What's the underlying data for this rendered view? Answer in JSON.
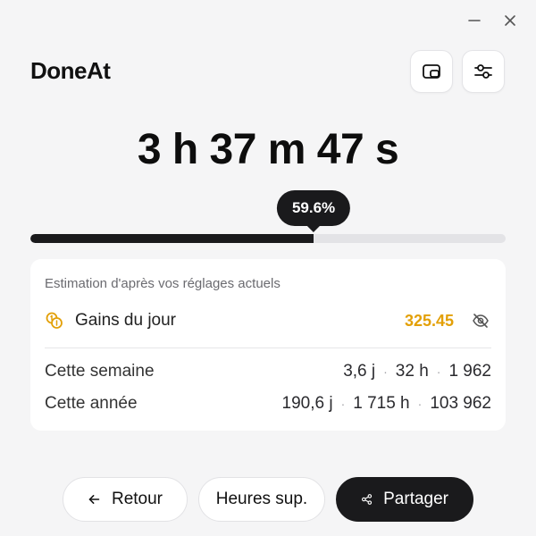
{
  "window": {
    "minimize_icon": "minimize-icon",
    "close_icon": "close-icon"
  },
  "app": {
    "title": "DoneAt"
  },
  "toolbar": {
    "pip_icon": "picture-in-picture-icon",
    "settings_icon": "sliders-icon"
  },
  "timer": {
    "elapsed": "3 h 37 m 47 s"
  },
  "progress": {
    "percent": 59.6,
    "label": "59.6%"
  },
  "estimate": {
    "caption": "Estimation d'après vos réglages actuels",
    "earnings": {
      "label": "Gains du jour",
      "value": "325.45",
      "icon": "coins-icon",
      "toggle_icon": "eye-off-icon"
    },
    "week": {
      "label": "Cette semaine",
      "days": "3,6 j",
      "hours": "32 h",
      "amount": "1 962"
    },
    "year": {
      "label": "Cette année",
      "days": "190,6 j",
      "hours": "1 715 h",
      "amount": "103 962"
    }
  },
  "footer": {
    "back_label": "Retour",
    "overtime_label": "Heures sup.",
    "share_label": "Partager"
  },
  "colors": {
    "background": "#f5f5f6",
    "accent_dark": "#1a1a1c",
    "earnings_gold": "#e3a008"
  }
}
